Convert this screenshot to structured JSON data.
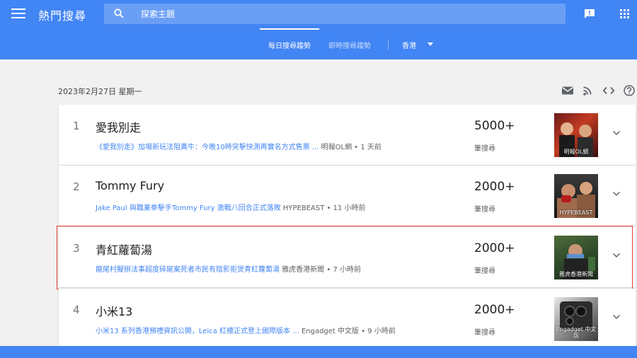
{
  "header": {
    "title": "熱門搜尋",
    "search_placeholder": "探索主題"
  },
  "tabs": [
    {
      "label": "每日搜尋趨勢",
      "active": true
    },
    {
      "label": "即時搜尋趨勢",
      "active": false
    }
  ],
  "region": "香港",
  "date": "2023年2月27日 星期一",
  "colors": {
    "brand": "#4285f4",
    "highlight": "#e53935"
  },
  "toolbar": [
    "mail-icon",
    "rss-icon",
    "embed-code-icon",
    "help-icon"
  ],
  "trends": [
    {
      "rank": "1",
      "title": "愛我別走",
      "article": "《愛我別走》加場新玩法阻黃牛：今晚10時突擊快測再實名方式售票 ...",
      "source": "明報OL網 • 1 天前",
      "count": "5000+",
      "count_label": "筆搜尋",
      "thumb_caption": "明報OL網"
    },
    {
      "rank": "2",
      "title": "Tommy Fury",
      "article": "Jake Paul 與職業拳擊手Tommy Fury 激戰八回合正式落敗",
      "source": "HYPEBEAST • 11 小時前",
      "count": "2000+",
      "count_label": "筆搜尋",
      "thumb_caption": "HYPEBEAST"
    },
    {
      "rank": "3",
      "title": "青紅蘿蔔湯",
      "article": "龍尾村擬辦法事超度碎屍案死者市民有陰影拒煲青紅蘿蔔湯",
      "source": "雅虎香港新聞 • 7 小時前",
      "count": "2000+",
      "count_label": "筆搜尋",
      "thumb_caption": "雅虎香港新聞"
    },
    {
      "rank": "4",
      "title": "小米13",
      "article": "小米13 系列香港預禮資訊公開，Leica 紅標正式登上國際版本 ...",
      "source": "Engadget 中文版 • 9 小時前",
      "count": "2000+",
      "count_label": "筆搜尋",
      "thumb_caption": "Engadget 中文版"
    }
  ]
}
